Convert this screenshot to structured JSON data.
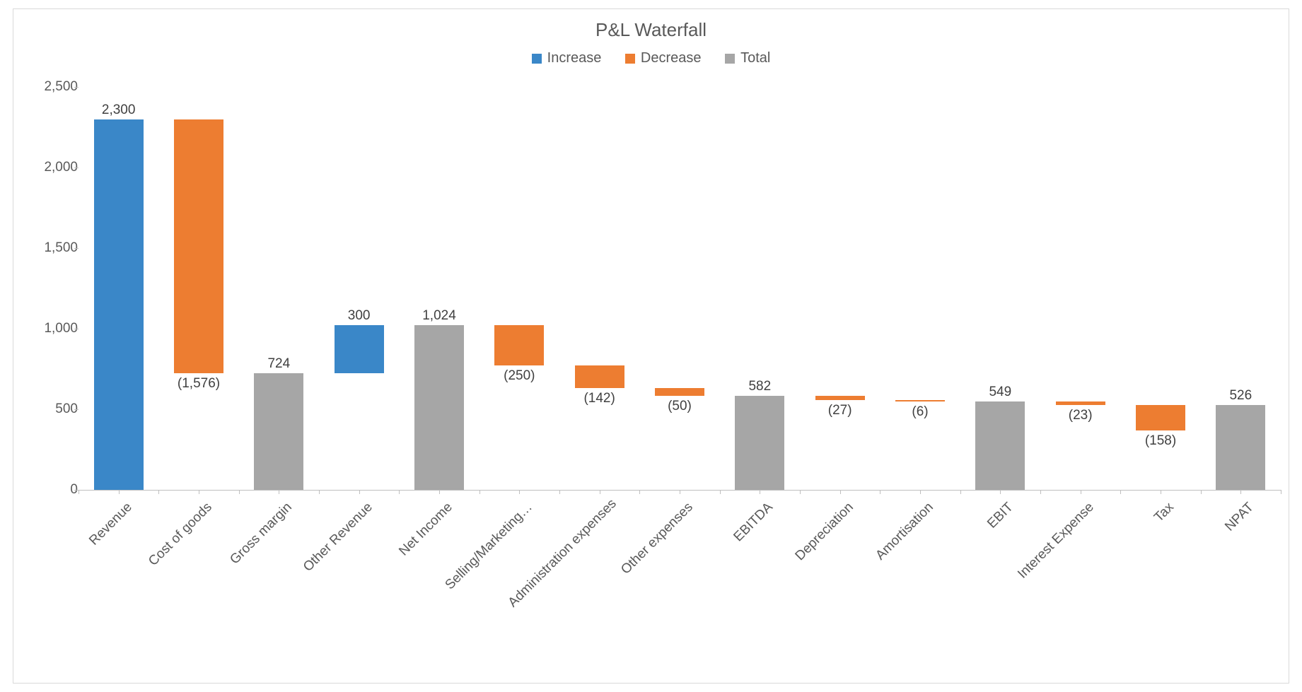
{
  "chart_data": {
    "type": "waterfall",
    "title": "P&L Waterfall",
    "ylabel": "",
    "xlabel": "",
    "ylim": [
      0,
      2500
    ],
    "y_ticks": [
      0,
      500,
      1000,
      1500,
      2000,
      2500
    ],
    "y_tick_labels": [
      "0",
      "500",
      "1,000",
      "1,500",
      "2,000",
      "2,500"
    ],
    "legend": [
      {
        "name": "Increase",
        "color": "#3a87c8"
      },
      {
        "name": "Decrease",
        "color": "#ed7d31"
      },
      {
        "name": "Total",
        "color": "#a6a6a6"
      }
    ],
    "categories": [
      "Revenue",
      "Cost of goods",
      "Gross margin",
      "Other Revenue",
      "Net Income",
      "Selling/Marketing…",
      "Administration expenses",
      "Other expenses",
      "EBITDA",
      "Depreciation",
      "Amortisation",
      "EBIT",
      "Interest Expense",
      "Tax",
      "NPAT"
    ],
    "items": [
      {
        "label": "2,300",
        "value": 2300,
        "type": "increase",
        "start": 0,
        "end": 2300
      },
      {
        "label": "(1,576)",
        "value": -1576,
        "type": "decrease",
        "start": 2300,
        "end": 724
      },
      {
        "label": "724",
        "value": 724,
        "type": "total",
        "start": 0,
        "end": 724
      },
      {
        "label": "300",
        "value": 300,
        "type": "increase",
        "start": 724,
        "end": 1024
      },
      {
        "label": "1,024",
        "value": 1024,
        "type": "total",
        "start": 0,
        "end": 1024
      },
      {
        "label": "(250)",
        "value": -250,
        "type": "decrease",
        "start": 1024,
        "end": 774
      },
      {
        "label": "(142)",
        "value": -142,
        "type": "decrease",
        "start": 774,
        "end": 632
      },
      {
        "label": "(50)",
        "value": -50,
        "type": "decrease",
        "start": 632,
        "end": 582
      },
      {
        "label": "582",
        "value": 582,
        "type": "total",
        "start": 0,
        "end": 582
      },
      {
        "label": "(27)",
        "value": -27,
        "type": "decrease",
        "start": 582,
        "end": 555
      },
      {
        "label": "(6)",
        "value": -6,
        "type": "decrease",
        "start": 555,
        "end": 549
      },
      {
        "label": "549",
        "value": 549,
        "type": "total",
        "start": 0,
        "end": 549
      },
      {
        "label": "(23)",
        "value": -23,
        "type": "decrease",
        "start": 549,
        "end": 526
      },
      {
        "label": "(158)",
        "value": -158,
        "type": "decrease",
        "start": 526,
        "end": 368
      },
      {
        "label": "526",
        "value": 526,
        "type": "total",
        "start": 0,
        "end": 526
      }
    ]
  },
  "colors": {
    "increase": "#3a87c8",
    "decrease": "#ed7d31",
    "total": "#a6a6a6"
  }
}
